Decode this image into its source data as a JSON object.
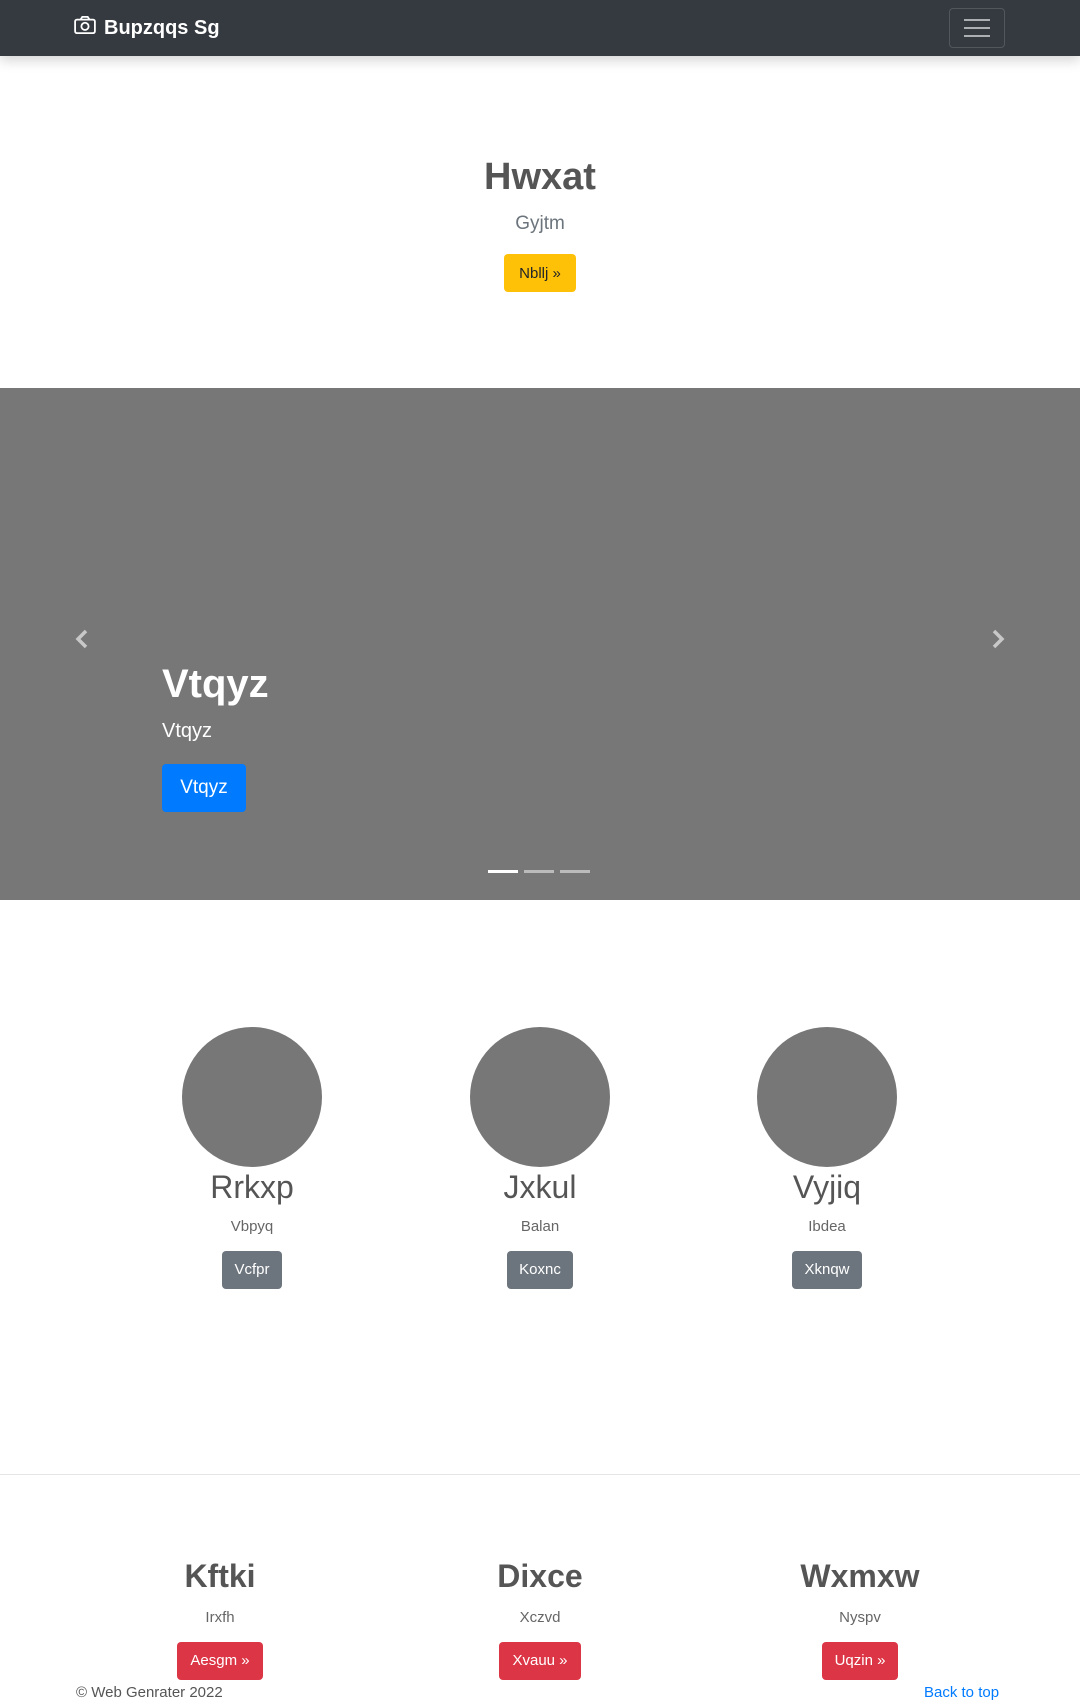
{
  "navbar": {
    "brand": "Bupzqqs Sg",
    "brand_icon": "camera-icon",
    "toggler_icon": "hamburger-icon"
  },
  "hero": {
    "title": "Hwxat",
    "subtitle": "Gyjtm",
    "button": "Nbllj »"
  },
  "carousel": {
    "caption_title": "Vtqyz",
    "caption_subtitle": "Vtqyz",
    "button": "Vtqyz",
    "prev_icon": "chevron-left-icon",
    "next_icon": "chevron-right-icon",
    "indicator_count": 3,
    "active_indicator": 0
  },
  "marketing": [
    {
      "title": "Rrkxp",
      "text": "Vbpyq",
      "button": "Vcfpr"
    },
    {
      "title": "Jxkul",
      "text": "Balan",
      "button": "Koxnc"
    },
    {
      "title": "Vyjiq",
      "text": "Ibdea",
      "button": "Xknqw"
    }
  ],
  "features": [
    {
      "title": "Kftki",
      "text": "Irxfh",
      "button": "Aesgm »"
    },
    {
      "title": "Dixce",
      "text": "Xczvd",
      "button": "Xvauu »"
    },
    {
      "title": "Wxmxw",
      "text": "Nyspv",
      "button": "Uqzin »"
    }
  ],
  "footer": {
    "copyright": "© Web Genrater 2022",
    "back_to_top": "Back to top"
  },
  "colors": {
    "navbar": "#343a40",
    "warning": "#ffc107",
    "primary": "#007bff",
    "secondary": "#6c757d",
    "danger": "#dc3545",
    "placeholder_gray": "#777777"
  }
}
